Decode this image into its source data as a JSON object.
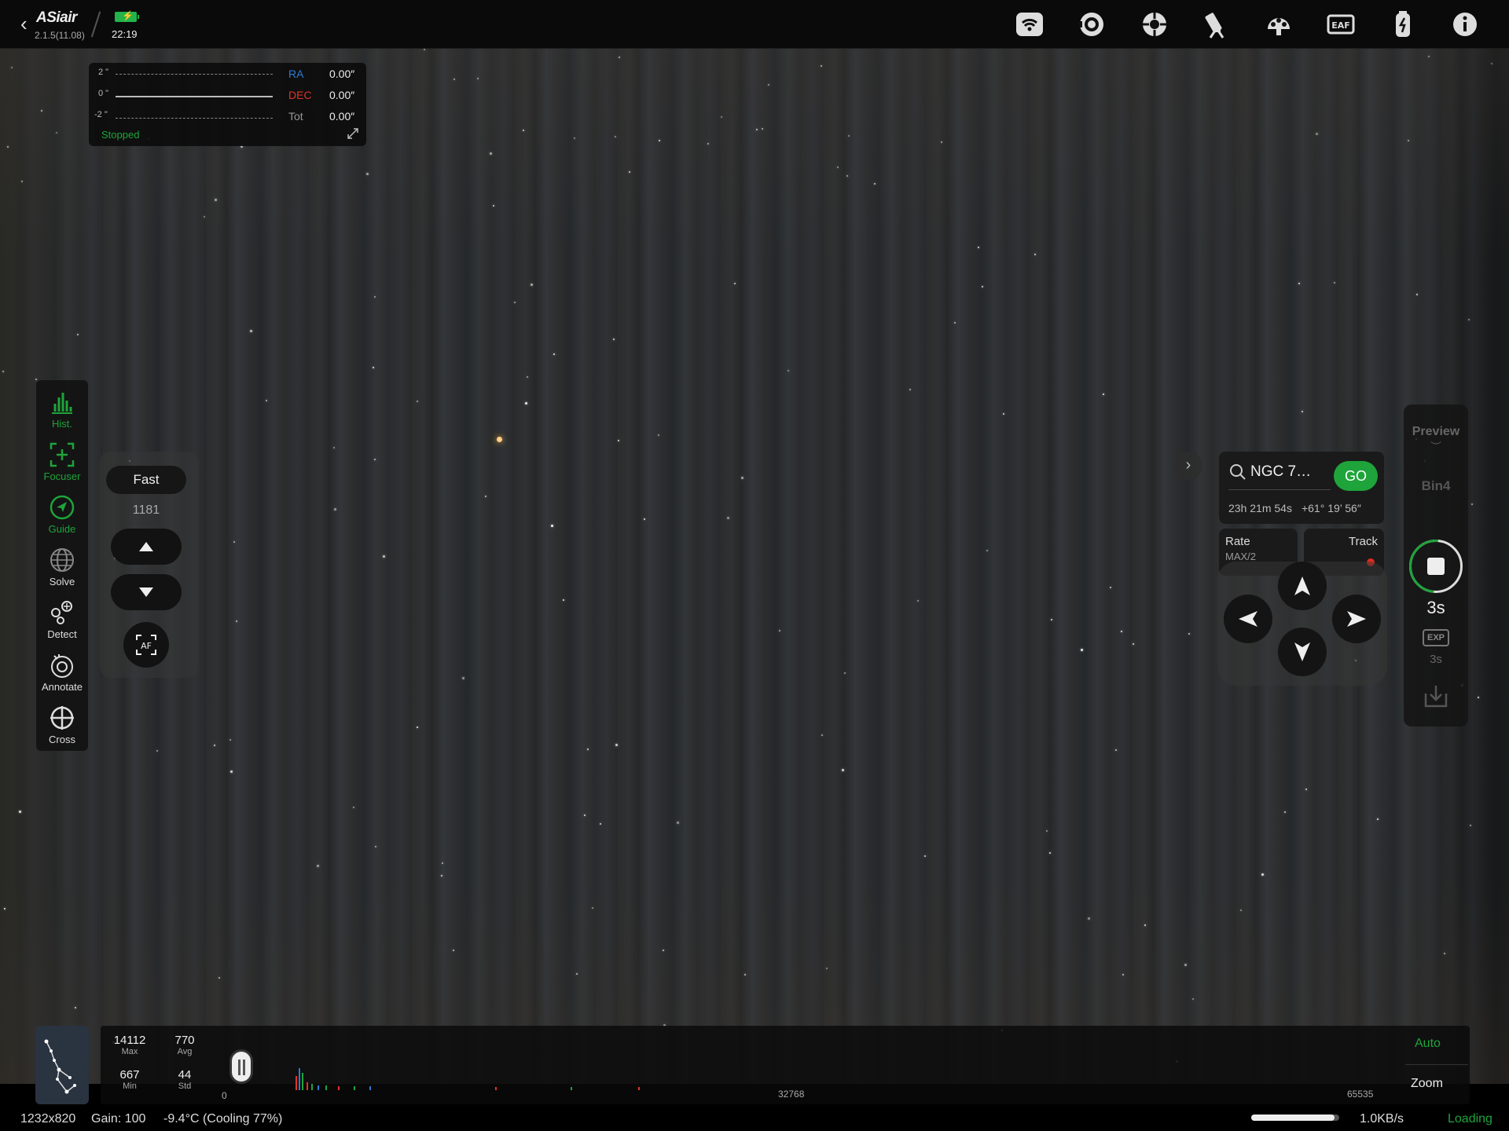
{
  "app": {
    "logo": "ASiair",
    "version": "2.1.5(11.08)",
    "time": "22:19",
    "accent": "#1ea43a"
  },
  "top_icons": [
    "wifi-icon",
    "camera-icon",
    "guide-camera-icon",
    "telescope-mount-icon",
    "filter-wheel-icon",
    "eaf-focuser-icon",
    "power-usb-icon",
    "info-icon"
  ],
  "guide_graph": {
    "y_labels": [
      "2 \"",
      "0 \"",
      "-2 \""
    ],
    "rows": [
      {
        "label": "RA",
        "value": "0.00″",
        "color": "#2e7bd6"
      },
      {
        "label": "DEC",
        "value": "0.00″",
        "color": "#e0342a"
      },
      {
        "label": "Tot",
        "value": "0.00″",
        "color": "#999999"
      }
    ],
    "status": "Stopped",
    "status_color": "#1ea43a"
  },
  "left_tools": [
    {
      "label": "Hist.",
      "icon": "histogram-icon",
      "active": true
    },
    {
      "label": "Focuser",
      "icon": "focuser-icon",
      "active": true
    },
    {
      "label": "Guide",
      "icon": "guide-icon",
      "active": true
    },
    {
      "label": "Solve",
      "icon": "globe-icon",
      "active": false
    },
    {
      "label": "Detect",
      "icon": "detect-icon",
      "active": false
    },
    {
      "label": "Annotate",
      "icon": "annotate-icon",
      "active": false
    },
    {
      "label": "Cross",
      "icon": "crosshair-icon",
      "active": false
    }
  ],
  "focuser": {
    "speed": "Fast",
    "position": "1181"
  },
  "mount": {
    "target": "NGC 7…",
    "go": "GO",
    "ra": "23h 21m 54s",
    "dec": "+61° 19’ 56″",
    "rate_title": "Rate",
    "rate_value": "MAX/2",
    "track_title": "Track",
    "track_state_color": "#e02b20"
  },
  "capture": {
    "mode": "Preview",
    "binning": "Bin4",
    "exposure": "3s",
    "exp_badge": "EXP",
    "exp_setting": "3s"
  },
  "histogram": {
    "max": "14112",
    "max_label": "Max",
    "avg": "770",
    "avg_label": "Avg",
    "min": "667",
    "min_label": "Min",
    "std": "44",
    "std_label": "Std",
    "ticks": [
      "0",
      "32768",
      "65535"
    ],
    "auto": "Auto",
    "zoom": "Zoom"
  },
  "status": {
    "resolution": "1232x820",
    "gain": "Gain: 100",
    "temp": "-9.4°C (Cooling 77%)",
    "progress": 0.95,
    "speed": "1.0KB/s",
    "state": "Loading"
  }
}
